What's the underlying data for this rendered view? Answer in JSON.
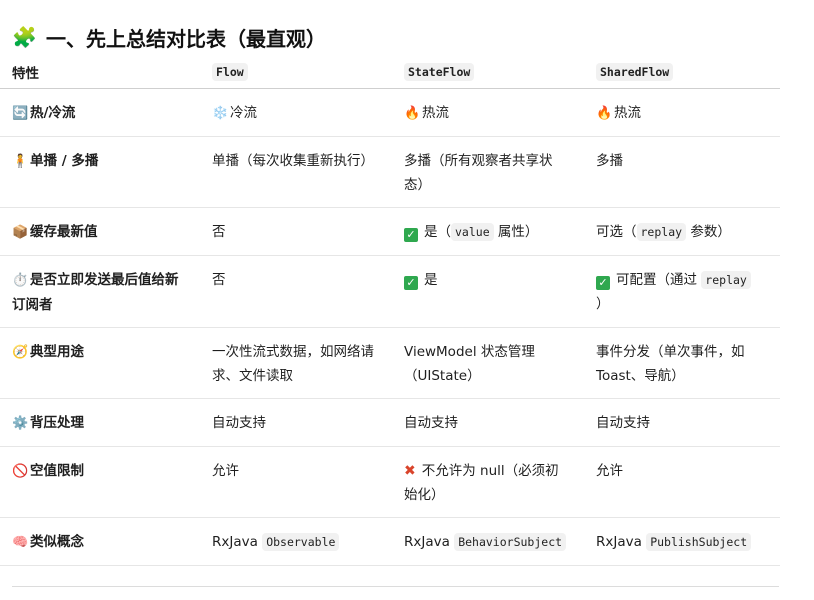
{
  "heading": {
    "emoji": "🧩",
    "text": "一、先上总结对比表（最直观）"
  },
  "table": {
    "headers": [
      "特性",
      "Flow",
      "StateFlow",
      "SharedFlow"
    ],
    "rows": [
      {
        "icon": "🔄",
        "feature": "热/冷流",
        "flow": {
          "icon": "❄️",
          "text": "冷流"
        },
        "stateflow": {
          "icon": "🔥",
          "text": "热流"
        },
        "sharedflow": {
          "icon": "🔥",
          "text": "热流"
        }
      },
      {
        "icon": "🧍",
        "feature": "单播 / 多播",
        "flow": {
          "text": "单播（每次收集重新执行）"
        },
        "stateflow": {
          "text": "多播（所有观察者共享状态）"
        },
        "sharedflow": {
          "text": "多播"
        }
      },
      {
        "icon": "📦",
        "feature": "缓存最新值",
        "flow": {
          "text": "否"
        },
        "stateflow": {
          "check": "✓",
          "pre": "是（",
          "code": "value",
          "post": " 属性）"
        },
        "sharedflow": {
          "pre": "可选（",
          "code": "replay",
          "post": " 参数）"
        }
      },
      {
        "icon": "⏱️",
        "feature": "是否立即发送最后值给新订阅者",
        "flow": {
          "text": "否"
        },
        "stateflow": {
          "check": "✓",
          "pre": "是"
        },
        "sharedflow": {
          "check": "✓",
          "pre": "可配置（通过 ",
          "code": "replay",
          "post": " ）"
        }
      },
      {
        "icon": "🧭",
        "feature": "典型用途",
        "flow": {
          "text": "一次性流式数据，如网络请求、文件读取"
        },
        "stateflow": {
          "text": "ViewModel 状态管理（UIState）"
        },
        "sharedflow": {
          "text": "事件分发（单次事件，如 Toast、导航）"
        }
      },
      {
        "icon": "⚙️",
        "feature": "背压处理",
        "flow": {
          "text": "自动支持"
        },
        "stateflow": {
          "text": "自动支持"
        },
        "sharedflow": {
          "text": "自动支持"
        }
      },
      {
        "icon": "🚫",
        "feature": "空值限制",
        "flow": {
          "text": "允许"
        },
        "stateflow": {
          "cross": "✖",
          "pre": "不允许为 null（必须初始化）"
        },
        "sharedflow": {
          "text": "允许"
        }
      },
      {
        "icon": "🧠",
        "feature": "类似概念",
        "flow": {
          "pre": "RxJava ",
          "code": "Observable"
        },
        "stateflow": {
          "pre": "RxJava ",
          "code": "BehaviorSubject"
        },
        "sharedflow": {
          "pre": "RxJava ",
          "code": "PublishSubject"
        }
      }
    ]
  }
}
